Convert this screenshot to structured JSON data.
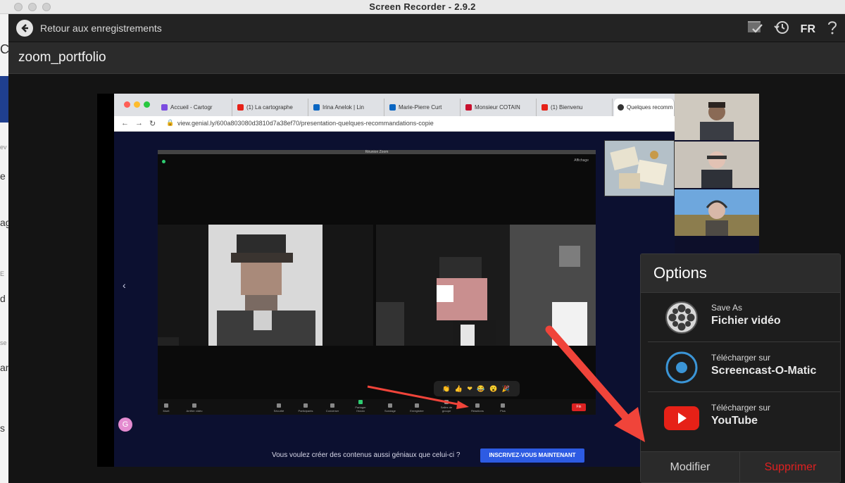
{
  "window": {
    "title": "Screen Recorder - 2.9.2"
  },
  "background_app": {
    "visible_letters": [
      "C",
      "ev",
      "e",
      "ag",
      "E",
      "d",
      "se",
      "an",
      "s"
    ]
  },
  "topbar": {
    "back_label": "Retour aux enregistrements",
    "language": "FR",
    "icons": [
      "list-check-icon",
      "history-icon",
      "help-icon"
    ]
  },
  "recording": {
    "name": "zoom_portfolio"
  },
  "video": {
    "browser_tabs": [
      "Accueil - Cartogr",
      "(1) La cartographe",
      "Irina Anelok | Lin",
      "Marie-Pierre Curt",
      "Monsieur COTAIN",
      "(1) Bienvenu",
      "Quelques recomm"
    ],
    "url": "view.genial.ly/600a803080d3810d7a38ef70/presentation-quelques-recommandations-copie",
    "zoom_title": "Réunion Zoom",
    "zoom_view_label": "Affichage",
    "zoom_controls": [
      "Muet",
      "Arrêter vidéo",
      "Sécurité",
      "Participants",
      "Converser",
      "Partager l'écran",
      "Sondage",
      "Enregistrer",
      "Salles de groupe",
      "Réactions",
      "Plus"
    ],
    "zoom_end": "Fin",
    "reactions": "👏 👍 ❤ 😂 😮 🎉",
    "cta_text": "Vous voulez créer des contenus aussi géniaux que celui-ci ?",
    "cta_button": "INSCRIVEZ-VOUS MAINTENANT"
  },
  "options": {
    "title": "Options",
    "items": [
      {
        "sub": "Save As",
        "main": "Fichier vidéo",
        "icon": "film-reel-icon"
      },
      {
        "sub": "Télécharger sur",
        "main": "Screencast-O-Matic",
        "icon": "screencast-o-matic-icon"
      },
      {
        "sub": "Télécharger sur",
        "main": "YouTube",
        "icon": "youtube-icon"
      }
    ],
    "modify": "Modifier",
    "delete": "Supprimer"
  },
  "colors": {
    "app_bg": "#1a1a1a",
    "accent_blue": "#3b95d6",
    "delete_red": "#e02020",
    "youtube_red": "#e62117",
    "annotation_arrow": "#f0443a"
  }
}
